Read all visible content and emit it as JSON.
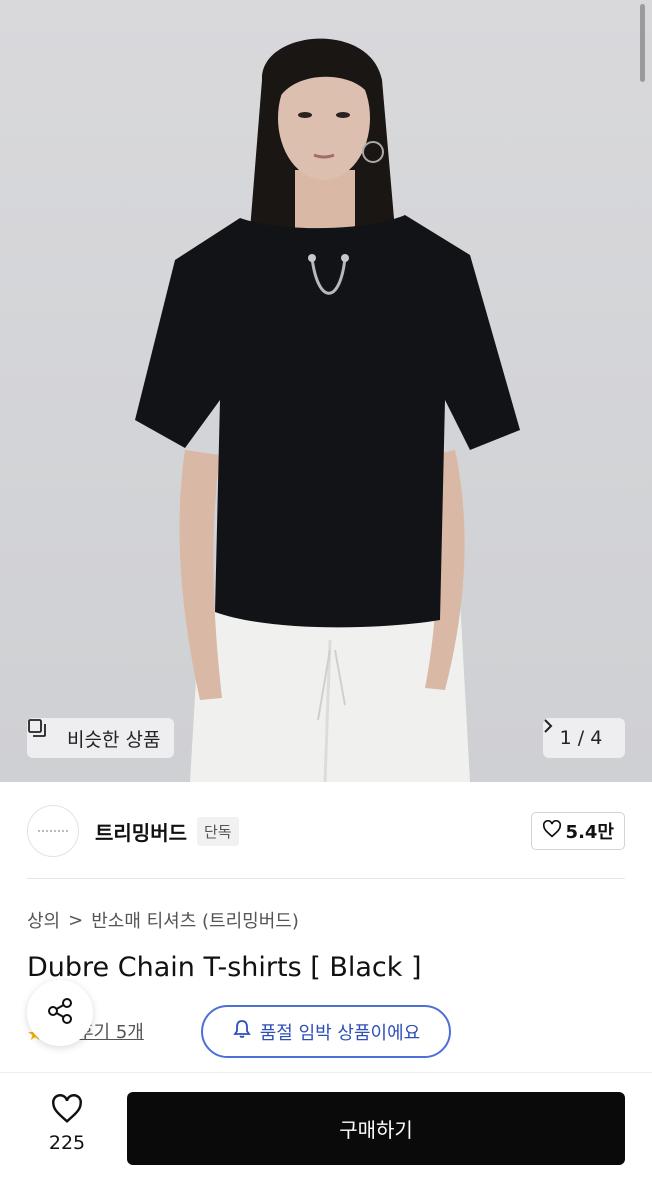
{
  "hero": {
    "similar_label": "비슷한 상품",
    "pager": "1 / 4",
    "icons": [
      "similar-icon",
      "chevron-right-icon"
    ]
  },
  "brand": {
    "name": "트리밍버드",
    "tag": "단독",
    "likes": "5.4만"
  },
  "breadcrumb": {
    "category": "상의",
    "separator": ">",
    "subcategory": "반소매 티셔츠 (트리밍버드)"
  },
  "product": {
    "title": "Dubre Chain T-shirts [ Black ]",
    "reviews_link": "후기 5개",
    "stock_notice": "품절 임박 상품이에요"
  },
  "bottom": {
    "wish_count": "225",
    "buy_label": "구매하기"
  },
  "colors": {
    "accent_blue": "#2f4fb8",
    "buy_button": "#0a0a0a",
    "star": "#f5b400"
  }
}
